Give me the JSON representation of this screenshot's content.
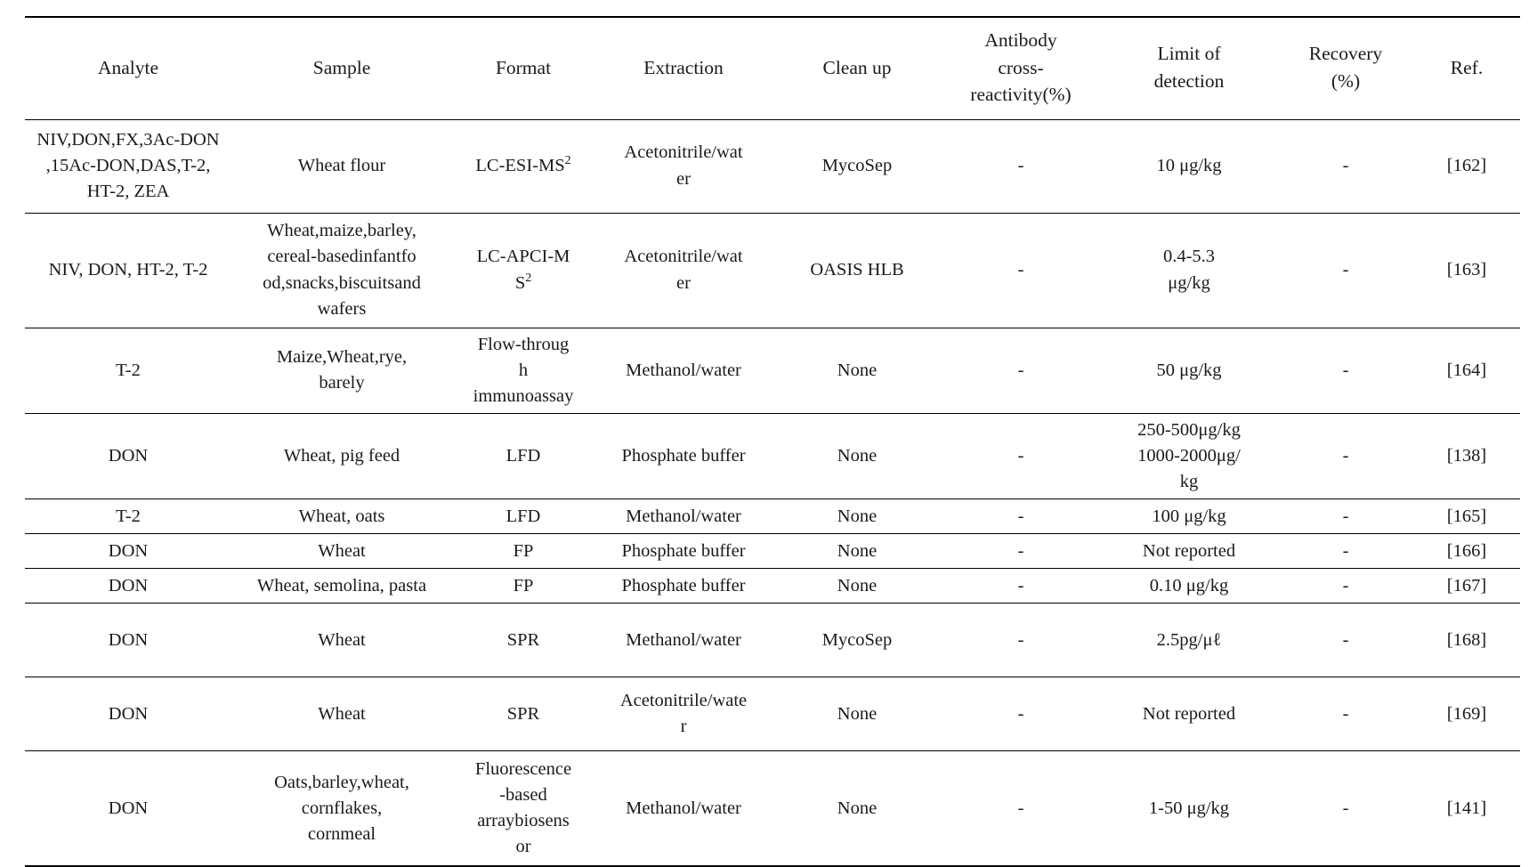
{
  "table": {
    "columns": [
      {
        "key": "analyte",
        "label": "Analyte"
      },
      {
        "key": "sample",
        "label": "Sample"
      },
      {
        "key": "format",
        "label": "Format"
      },
      {
        "key": "extraction",
        "label": "Extraction"
      },
      {
        "key": "cleanup",
        "label": "Clean up"
      },
      {
        "key": "cross",
        "label": "Antibody\ncross-\nreactivity(%)"
      },
      {
        "key": "lod",
        "label": "Limit of\ndetection"
      },
      {
        "key": "recovery",
        "label": "Recovery\n(%)"
      },
      {
        "key": "ref",
        "label": "Ref."
      }
    ],
    "rows": [
      {
        "analyte": "NIV,DON,FX,3Ac-DON\n,15Ac-DON,DAS,T-2,\nHT-2, ZEA",
        "sample": "Wheat flour",
        "format": "LC-ESI-MS",
        "format_sup": "2",
        "extraction": "Acetonitrile/wat\ner",
        "cleanup": "MycoSep",
        "cross": "-",
        "lod": "10  μg/kg",
        "recovery": "-",
        "ref": "[162]"
      },
      {
        "analyte": "NIV, DON, HT-2, T-2",
        "sample": "Wheat,maize,barley,\ncereal-basedinfantfo\nod,snacks,biscuitsand\nwafers",
        "format": "LC-APCI-M\nS",
        "format_sup": "2",
        "extraction": "Acetonitrile/wat\ner",
        "cleanup": "OASIS HLB",
        "cross": "-",
        "lod": "0.4-5.3\nμg/kg",
        "recovery": "-",
        "ref": "[163]"
      },
      {
        "analyte": "T-2",
        "sample": "Maize,Wheat,rye,\nbarely",
        "format": "Flow-throug\nh\nimmunoassay",
        "format_sup": "",
        "extraction": "Methanol/water",
        "cleanup": "None",
        "cross": "-",
        "lod": "50  μg/kg",
        "recovery": "-",
        "ref": "[164]"
      },
      {
        "analyte": "DON",
        "sample": "Wheat, pig feed",
        "format": "LFD",
        "format_sup": "",
        "extraction": "Phosphate buffer",
        "cleanup": "None",
        "cross": "-",
        "lod": "250-500μg/kg\n1000-2000μg/\nkg",
        "recovery": "-",
        "ref": "[138]"
      },
      {
        "analyte": "T-2",
        "sample": "Wheat, oats",
        "format": "LFD",
        "format_sup": "",
        "extraction": "Methanol/water",
        "cleanup": "None",
        "cross": "-",
        "lod": "100  μg/kg",
        "recovery": "-",
        "ref": "[165]"
      },
      {
        "analyte": "DON",
        "sample": "Wheat",
        "format": "FP",
        "format_sup": "",
        "extraction": "Phosphate buffer",
        "cleanup": "None",
        "cross": "-",
        "lod": "Not reported",
        "recovery": "-",
        "ref": "[166]"
      },
      {
        "analyte": "DON",
        "sample": "Wheat, semolina, pasta",
        "format": "FP",
        "format_sup": "",
        "extraction": "Phosphate buffer",
        "cleanup": "None",
        "cross": "-",
        "lod": "0.10  μg/kg",
        "recovery": "-",
        "ref": "[167]"
      },
      {
        "analyte": "DON",
        "sample": "Wheat",
        "format": "SPR",
        "format_sup": "",
        "extraction": "Methanol/water",
        "cleanup": "MycoSep",
        "cross": "-",
        "lod": "2.5pg/μℓ",
        "recovery": "-",
        "ref": "[168]"
      },
      {
        "analyte": "DON",
        "sample": "Wheat",
        "format": "SPR",
        "format_sup": "",
        "extraction": "Acetonitrile/wate\nr",
        "cleanup": "None",
        "cross": "-",
        "lod": "Not reported",
        "recovery": "-",
        "ref": "[169]"
      },
      {
        "analyte": "DON",
        "sample": "Oats,barley,wheat,\ncornflakes,\ncornmeal",
        "format": "Fluorescence\n-based\narraybiosens\nor",
        "format_sup": "",
        "extraction": "Methanol/water",
        "cleanup": "None",
        "cross": "-",
        "lod": "1-50  μg/kg",
        "recovery": "-",
        "ref": "[141]"
      }
    ]
  }
}
